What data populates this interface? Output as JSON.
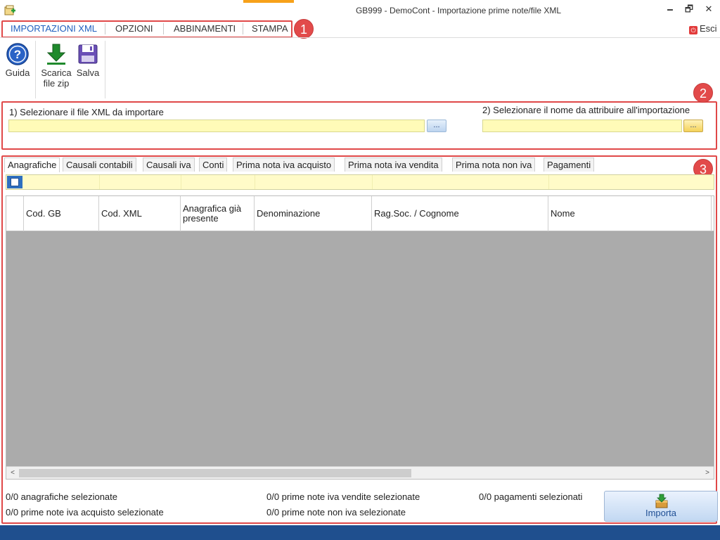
{
  "window": {
    "title": "GB999 - DemoCont - Importazione prime note/file XML",
    "minimize": "🗕",
    "maximize": "🗗",
    "close": "✕",
    "exit_label": "Esci",
    "exit_icon": "power-icon"
  },
  "menu": {
    "items": [
      {
        "label": "IMPORTAZIONI XML",
        "active": true
      },
      {
        "label": "OPZIONI",
        "active": false
      },
      {
        "label": "ABBINAMENTI",
        "active": false
      },
      {
        "label": "STAMPA",
        "active": false
      }
    ]
  },
  "annotations": {
    "badge1": "1",
    "badge2": "2",
    "badge3": "3",
    "color": "#e24a4a"
  },
  "ribbon": {
    "guida": {
      "label": "Guida",
      "icon": "help-icon"
    },
    "scarica": {
      "label_line1": "Scarica",
      "label_line2": "file zip",
      "icon": "download-icon"
    },
    "salva": {
      "label": "Salva",
      "icon": "floppy-disk-icon"
    }
  },
  "selection": {
    "file_label": "1) Selezionare il file XML da importare",
    "file_value": "",
    "file_browse": "...",
    "name_label": "2) Selezionare il nome da attribuire all'importazione",
    "name_value": "",
    "name_browse": "..."
  },
  "tabs": [
    {
      "label": "Anagrafiche",
      "active": true
    },
    {
      "label": "Causali contabili",
      "active": false
    },
    {
      "label": "Causali iva",
      "active": false
    },
    {
      "label": "Conti",
      "active": false
    },
    {
      "label": "Prima nota iva acquisto",
      "active": false
    },
    {
      "label": "Prima nota iva vendita",
      "active": false
    },
    {
      "label": "Prima nota non iva",
      "active": false
    },
    {
      "label": "Pagamenti",
      "active": false
    }
  ],
  "grid": {
    "columns": [
      {
        "label": "Cod. GB"
      },
      {
        "label": "Cod. XML"
      },
      {
        "label": "Anagrafica già presente"
      },
      {
        "label": "Denominazione"
      },
      {
        "label": "Rag.Soc. / Cognome"
      },
      {
        "label": "Nome"
      }
    ],
    "rows": [],
    "scroll_left": "<",
    "scroll_right": ">"
  },
  "status": {
    "anagrafiche": "0/0 anagrafiche selezionate",
    "acquisto": "0/0 prime note iva acquisto selezionate",
    "vendite": "0/0 prime note iva vendite selezionate",
    "non_iva": "0/0 prime note non iva selezionate",
    "pagamenti": "0/0 pagamenti selezionati"
  },
  "import_button": {
    "label": "Importa",
    "icon": "import-box-icon"
  },
  "colors": {
    "accent": "#1f5fbf",
    "input_bg": "#fffbb8",
    "bottom_bar": "#1f4f8e",
    "grid_bg": "#ababab"
  }
}
